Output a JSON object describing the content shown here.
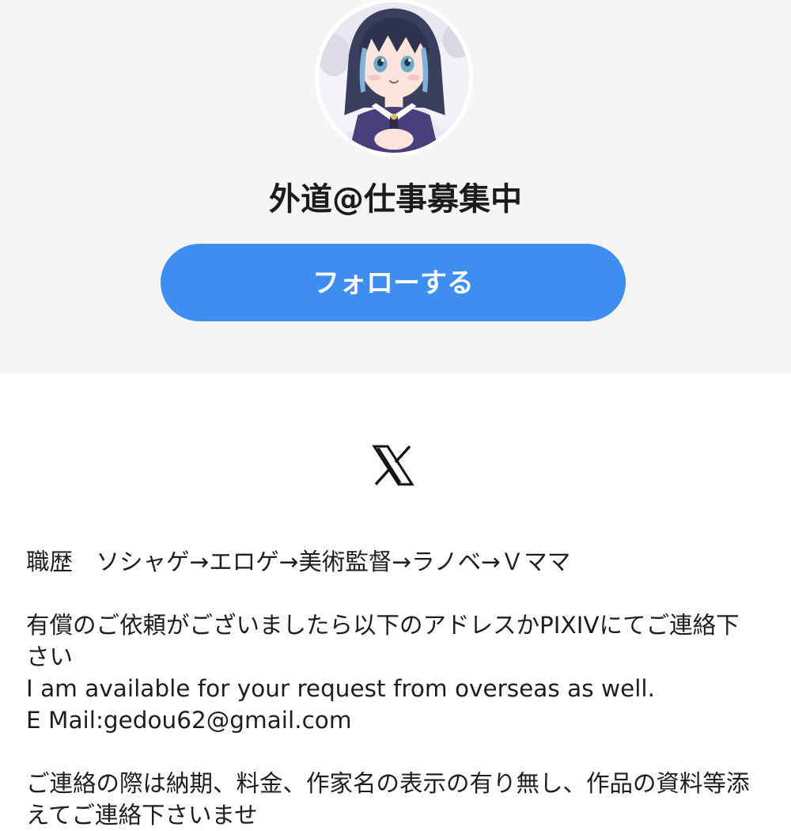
{
  "profile": {
    "display_name": "外道@仕事募集中",
    "follow_label": "フォローする",
    "social_link_icon": "x-logo-icon"
  },
  "bio": {
    "career": "職歴　ソシャゲ→エロゲ→美術監督→ラノベ→Ｖママ",
    "request_jp": "有償のご依頼がございましたら以下のアドレスかPIXIVにてご連絡下さい",
    "request_en": "I am available for your request from overseas as well.",
    "email": "E Mail:gedou62@gmail.com",
    "contact_note": "ご連絡の際は納期、料金、作家名の表示の有り無し、作品の資料等添えてご連絡下さいませ"
  },
  "colors": {
    "header_bg": "#f5f5f5",
    "accent": "#3d8ef0",
    "text": "#1e1e1e"
  }
}
